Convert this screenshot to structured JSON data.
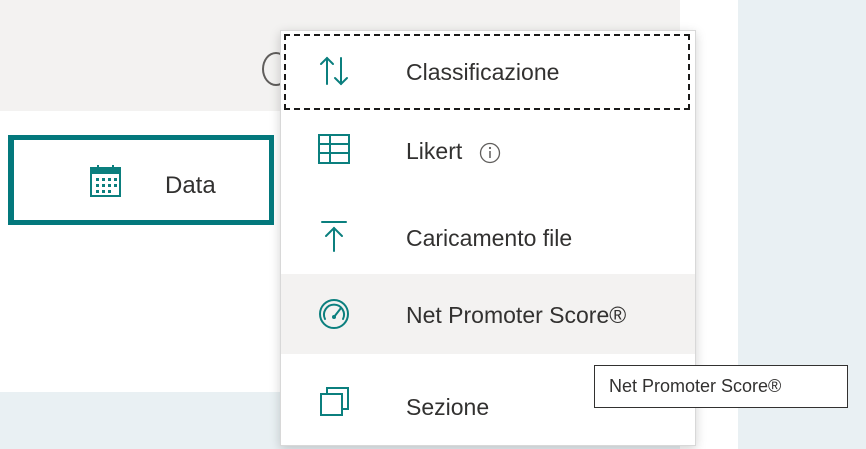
{
  "date_card": {
    "label": "Data",
    "icon": "calendar-icon"
  },
  "menu": {
    "items": [
      {
        "label": "Classificazione",
        "icon": "sort-arrows-icon",
        "state": "focused"
      },
      {
        "label": "Likert",
        "icon": "grid-table-icon",
        "info_icon": "info-icon"
      },
      {
        "label": "Caricamento file",
        "icon": "upload-icon"
      },
      {
        "label": "Net Promoter Score®",
        "icon": "gauge-icon",
        "state": "hover"
      },
      {
        "label": "Sezione",
        "icon": "section-copy-icon"
      }
    ]
  },
  "tooltip": {
    "text": "Net Promoter Score®"
  },
  "colors": {
    "accent": "#03787c",
    "icon": "#0b7f7e",
    "hover_bg": "#f3f2f1",
    "panel_bg": "#e9f0f3"
  }
}
